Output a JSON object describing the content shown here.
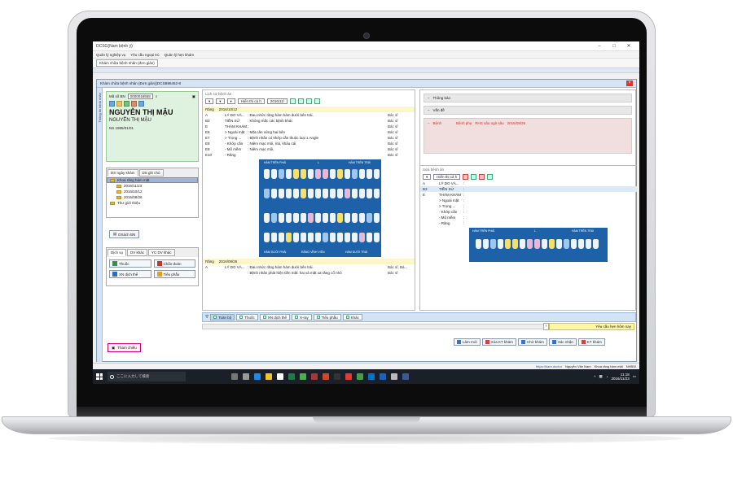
{
  "window": {
    "title": "DCSG(Nam bệnh ý)"
  },
  "menu": [
    "Quản lý nghiệp vụ",
    "Yêu cầu ngoại trú",
    "Quản lý hẹn khám"
  ],
  "toolbar": {
    "tab_label": "Khám chữa bệnh nhân (đơn giản)"
  },
  "inner": {
    "title": "Khám chữa bệnh nhân (Đơn giản)(DCSB96452-8",
    "side_tab": "Thông tin bệnh nhân"
  },
  "patient": {
    "id_label": "Mã số BN",
    "id_value": "0000016558",
    "name": "NGUYỄN THỊ MẬU",
    "name_sub": "NGUYỄN THỊ MẬU",
    "dob_label": "NS",
    "dob_value": "1985/01/01"
  },
  "history_tabs": [
    "DS ngày khám",
    "DS ghi chú"
  ],
  "tree": {
    "root": "Khoa răng hàm mặt",
    "dates": [
      "2016/11/23",
      "2016/10/12",
      "2016/08/26"
    ],
    "other": "Thư giới thiệu"
  },
  "btn_dsbn": "DSách BN",
  "service_tabs": [
    "Dịch vụ",
    "DV khác",
    "YC DV khác"
  ],
  "services": [
    "Thuốc",
    "Chẩn đoán",
    "XN dịch thể",
    "Tiểu phẫu"
  ],
  "btn_thamchieu": "Tham chiếu",
  "mid": {
    "header": "Lịch sử bệnh án",
    "filter": "Hiển thị cả h",
    "filter_date": "2016/11/",
    "rec1": {
      "dept": "Răng",
      "date": "2016/10/12"
    },
    "rows": [
      {
        "code": "A",
        "label": "LÝ DO VÀ...",
        "text": ": Đau nhức răng hàm hàm dưới bên trái.",
        "doc": "Bác sĩ"
      },
      {
        "code": "B3",
        "label": "TIỀN SỬ",
        "text": ": Không mắc các bệnh khác",
        "doc": "Bác sĩ"
      },
      {
        "code": "E",
        "label": "THĂM KHÁM",
        "text": ":",
        "doc": "Bác sĩ"
      },
      {
        "code": "E6",
        "label": "> Ngoài mặt",
        "text": ": Mặt cân xứng hai bên",
        "doc": "Bác sĩ"
      },
      {
        "code": "E7",
        "label": "> Trong ...",
        "text": ": Bệnh nhân có khớp cắn thuộc loại 1 Angle",
        "doc": "Bác sĩ"
      },
      {
        "code": "E8",
        "label": "- Khớp cắn",
        "text": ": Niêm mạc môi, má, khẩu cái",
        "doc": "Bác sĩ"
      },
      {
        "code": "E9",
        "label": "- Mô mềm",
        "text": ": Niêm mạc môi,",
        "doc": "Bác sĩ"
      },
      {
        "code": "E10",
        "label": "- Răng",
        "text": "",
        "doc": "Bác sĩ"
      }
    ],
    "rec2": {
      "dept": "Răng",
      "date": "2016/08/26"
    },
    "rows2": [
      {
        "code": "A",
        "label": "LÝ DO VÀ...",
        "text": ": Đau nhức răng hàm hàm dưới bên trái.",
        "doc": "Bác sĩ, Bá..."
      },
      {
        "code": "",
        "label": "",
        "text": ": Bệnh nhân phát hiện tiền mặt: hai và mặt xa răng cổ nhỏ",
        "doc": "Bác sĩ"
      }
    ],
    "teeth_labels": {
      "ul": "HÀM TRÊN PHẢI",
      "ur": "HÀM TRÊN TRÁI",
      "ll": "HÀM DƯỚI PHẢI",
      "lc": "RĂNG VĨNH VIỄN",
      "lr": "HÀM DƯỚI TRÁI",
      "mid": "L"
    }
  },
  "right": {
    "sections": [
      "Thông báo",
      "Vấn đề"
    ],
    "pink": {
      "label": "Bệnh",
      "a": "Bệnh phụ",
      "b": "RHS sâu ngà sâu",
      "c": "2016/08/26"
    },
    "sub_header": "Sửa bệnh án",
    "filter": "Hiển thị cả h",
    "rows": [
      {
        "code": "A",
        "label": "LÝ DO VÀ..."
      },
      {
        "code": "B3",
        "label": "TIỀN SỬ"
      },
      {
        "code": "E",
        "label": "THĂM KHÁM"
      },
      {
        "code": "",
        "label": "> Ngoài mặt"
      },
      {
        "code": "",
        "label": "> Trong ..."
      },
      {
        "code": "",
        "label": "- Khớp cắn"
      },
      {
        "code": "",
        "label": "- Mô mềm"
      },
      {
        "code": "",
        "label": "- Răng"
      }
    ]
  },
  "bottom_tabs": [
    "Toàn bộ",
    "Thuốc",
    "XN dịch thể",
    "X-ray",
    "Tiểu phẫu",
    "Khác"
  ],
  "notice": "Yêu cầu hẹn hôm nay",
  "actions": [
    "Làm mới",
    "Xóa KT khám",
    "Chờ khám",
    "Xác nhận",
    "KT khám"
  ],
  "status": {
    "url": "https://kare.doctor",
    "user": "Nguyễn Văn Nam",
    "dept": "Khoa răng hàm mặt",
    "code": "NHBW"
  },
  "taskbar": {
    "search_placeholder": "ここに入力して検索",
    "time": "11:18",
    "date": "2016/11/23"
  }
}
